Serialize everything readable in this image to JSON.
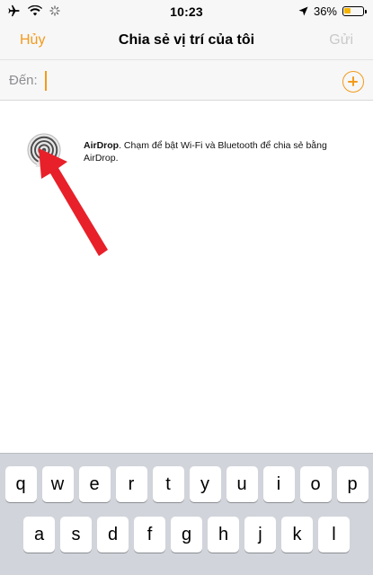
{
  "status_bar": {
    "time": "10:23",
    "battery": "36%",
    "battery_level": 0.36,
    "icons": [
      "airplane-icon",
      "wifi-icon",
      "activity-spinner-icon",
      "location-arrow-icon",
      "battery-icon"
    ]
  },
  "nav": {
    "cancel_label": "Hủy",
    "title": "Chia sẻ vị trí của tôi",
    "send_label": "Gửi"
  },
  "to_field": {
    "label": "Đến:",
    "value": "",
    "placeholder": ""
  },
  "airdrop": {
    "title": "AirDrop",
    "description": ". Chạm để bật Wi-Fi và Bluetooth để chia sẻ bằng AirDrop."
  },
  "keyboard": {
    "row1": [
      "q",
      "w",
      "e",
      "r",
      "t",
      "y",
      "u",
      "i",
      "o",
      "p"
    ],
    "row2": [
      "a",
      "s",
      "d",
      "f",
      "g",
      "h",
      "j",
      "k",
      "l"
    ]
  },
  "colors": {
    "accent": "#f39a1c",
    "disabled": "#c9c9c9",
    "arrow": "#e8202a",
    "keyboard_bg": "#d1d4da"
  }
}
